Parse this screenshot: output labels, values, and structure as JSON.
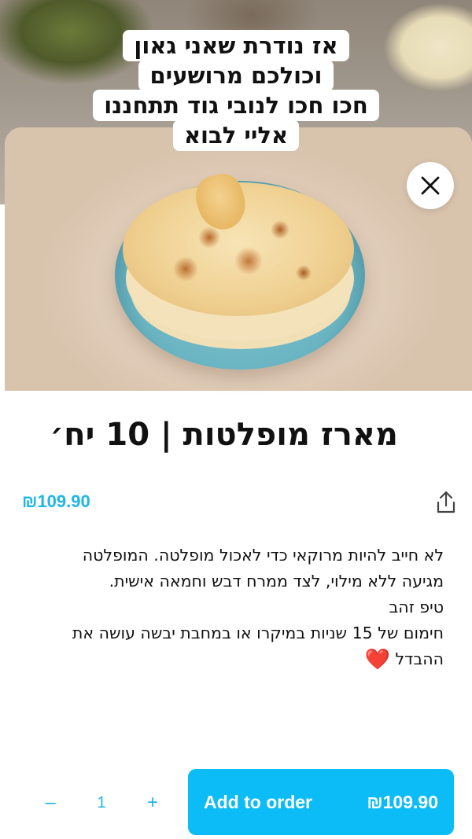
{
  "caption": {
    "lines": [
      "אז נודרת שאני גאון",
      "וכולכם מרושעים",
      "חכו חכו לנובי גוד תתחננו",
      "אליי לבוא"
    ]
  },
  "close_icon": "close-icon",
  "product": {
    "title": "מארז מופלטות | 10 יח׳",
    "price": "₪109.90",
    "description_lines": [
      "לא חייב להיות מרוקאי כדי לאכול מופלטה. המופלטה",
      "מגיעה ללא מילוי, לצד ממרח דבש וחמאה אישית.",
      "טיפ זהב",
      "חימום של 15 שניות במיקרו או במחבת יבשה עושה את",
      "ההבדל"
    ],
    "heart": "❤️"
  },
  "order": {
    "decrement_label": "–",
    "quantity": "1",
    "increment_label": "+",
    "add_label": "Add to order",
    "add_price": "₪109.90"
  },
  "colors": {
    "accent": "#1fb6e8",
    "button": "#0cbcf6",
    "heart": "#e3191f"
  }
}
